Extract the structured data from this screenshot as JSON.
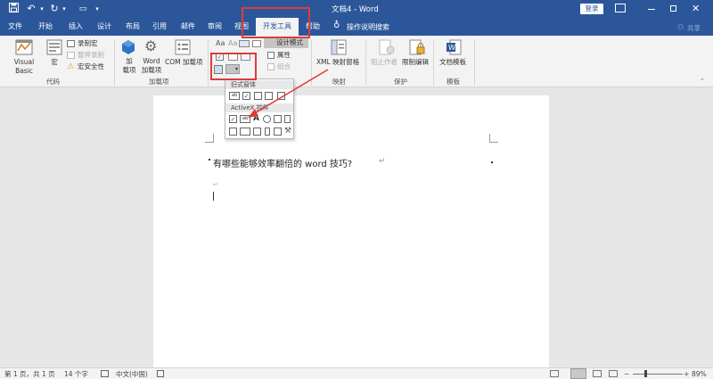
{
  "window": {
    "title": "文档4 - Word",
    "login_label": "登录",
    "share_label": "共享"
  },
  "tabs": [
    "文件",
    "开始",
    "插入",
    "设计",
    "布局",
    "引用",
    "邮件",
    "审阅",
    "视图",
    "开发工具",
    "帮助"
  ],
  "active_tab": "开发工具",
  "tell_me": "操作说明搜索",
  "ribbon": {
    "code": {
      "label": "代码",
      "visual_basic": "Visual Basic",
      "macros": "宏",
      "record_macro": "录制宏",
      "pause_recording": "暂停录制",
      "macro_security": "宏安全性"
    },
    "addins": {
      "label": "加载项",
      "addins": "加\n载项",
      "word_addins": "Word\n加载项",
      "com_addins": "COM 加载项"
    },
    "controls": {
      "design_mode": "设计模式",
      "properties": "属性",
      "group": "组合"
    },
    "mapping": {
      "label": "映射",
      "xml_pane": "XML 映射窗格"
    },
    "protect": {
      "label": "保护",
      "block_authors": "阻止作者",
      "restrict_editing": "限制编辑"
    },
    "templates": {
      "label": "模板",
      "document_template": "文档模板"
    }
  },
  "popup": {
    "legacy_label": "旧式窗体",
    "activex_label": "ActiveX 控件"
  },
  "document": {
    "line1": "有哪些能够效率翻倍的 word 技巧?",
    "para_mark": "↵"
  },
  "status": {
    "page": "第 1 页，共 1 页",
    "words": "14 个字",
    "language": "中文(中国)",
    "zoom": "89%"
  },
  "colors": {
    "brand": "#2b579a",
    "annotation": "#e03a3a"
  }
}
